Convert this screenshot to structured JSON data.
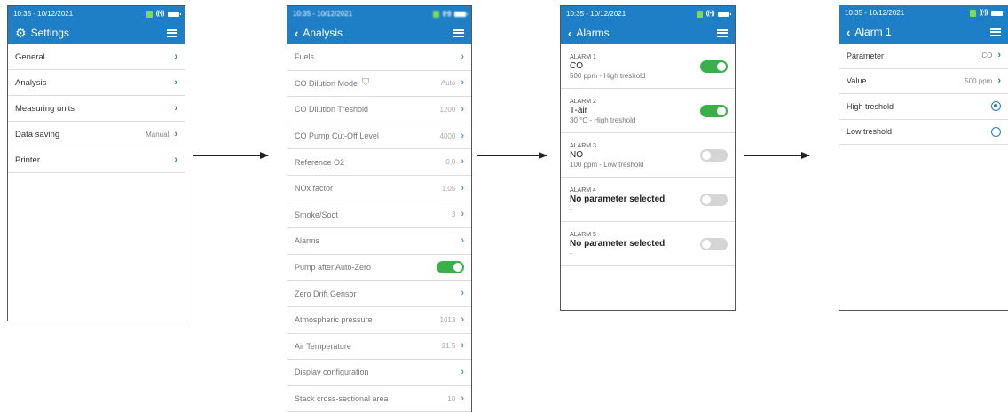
{
  "settings": {
    "status_time": "10:35 - 10/12/2021",
    "title": "Settings",
    "items": [
      {
        "label": "General",
        "value": ""
      },
      {
        "label": "Analysis",
        "value": ""
      },
      {
        "label": "Measuring units",
        "value": ""
      },
      {
        "label": "Data saving",
        "value": "Manual"
      },
      {
        "label": "Printer",
        "value": ""
      }
    ]
  },
  "analysis": {
    "status_time": "10:35 - 10/12/2021",
    "title": "Analysis",
    "items": [
      {
        "label": "Fuels",
        "value": ""
      },
      {
        "label": "CO Dilution Mode",
        "value": "Auto"
      },
      {
        "label": "CO Dilution Treshold",
        "value": "1200"
      },
      {
        "label": "CO Pump Cut-Off Level",
        "value": "4000"
      },
      {
        "label": "Reference O2",
        "value": "0.0"
      },
      {
        "label": "NOx factor",
        "value": "1.05"
      },
      {
        "label": "Smoke/Soot",
        "value": "3"
      },
      {
        "label": "Alarms",
        "value": ""
      },
      {
        "label": "Pump after Auto-Zero",
        "value": ""
      },
      {
        "label": "Zero Drift Gensor",
        "value": ""
      },
      {
        "label": "Atmospheric pressure",
        "value": "1013"
      },
      {
        "label": "Air Temperature",
        "value": "21.5"
      },
      {
        "label": "Display configuration",
        "value": ""
      },
      {
        "label": "Stack cross-sectional area",
        "value": "10"
      }
    ]
  },
  "alarms": {
    "status_time": "10:35 - 10/12/2021",
    "title": "Alarms",
    "items": [
      {
        "label": "ALARM 1",
        "param": "CO",
        "detail": "500 ppm - High treshold",
        "on": true
      },
      {
        "label": "ALARM 2",
        "param": "T-air",
        "detail": "30 °C - High treshold",
        "on": true
      },
      {
        "label": "ALARM 3",
        "param": "NO",
        "detail": "100 ppm - Low treshold",
        "on": false
      },
      {
        "label": "ALARM 4",
        "param": "No parameter selected",
        "detail": "-",
        "on": false
      },
      {
        "label": "ALARM 5",
        "param": "No parameter selected",
        "detail": "-",
        "on": false
      }
    ]
  },
  "alarm1": {
    "status_time": "10:35 - 10/12/2021",
    "title": "Alarm 1",
    "items": [
      {
        "label": "Parameter",
        "value": "CO"
      },
      {
        "label": "Value",
        "value": "500 ppm"
      },
      {
        "label": "High treshold",
        "checked": true
      },
      {
        "label": "Low treshold",
        "checked": false
      }
    ]
  },
  "colors": {
    "header_blue": "#1e7fc7",
    "toggle_on": "#3bb04a",
    "toggle_off": "#d5d5d5"
  }
}
